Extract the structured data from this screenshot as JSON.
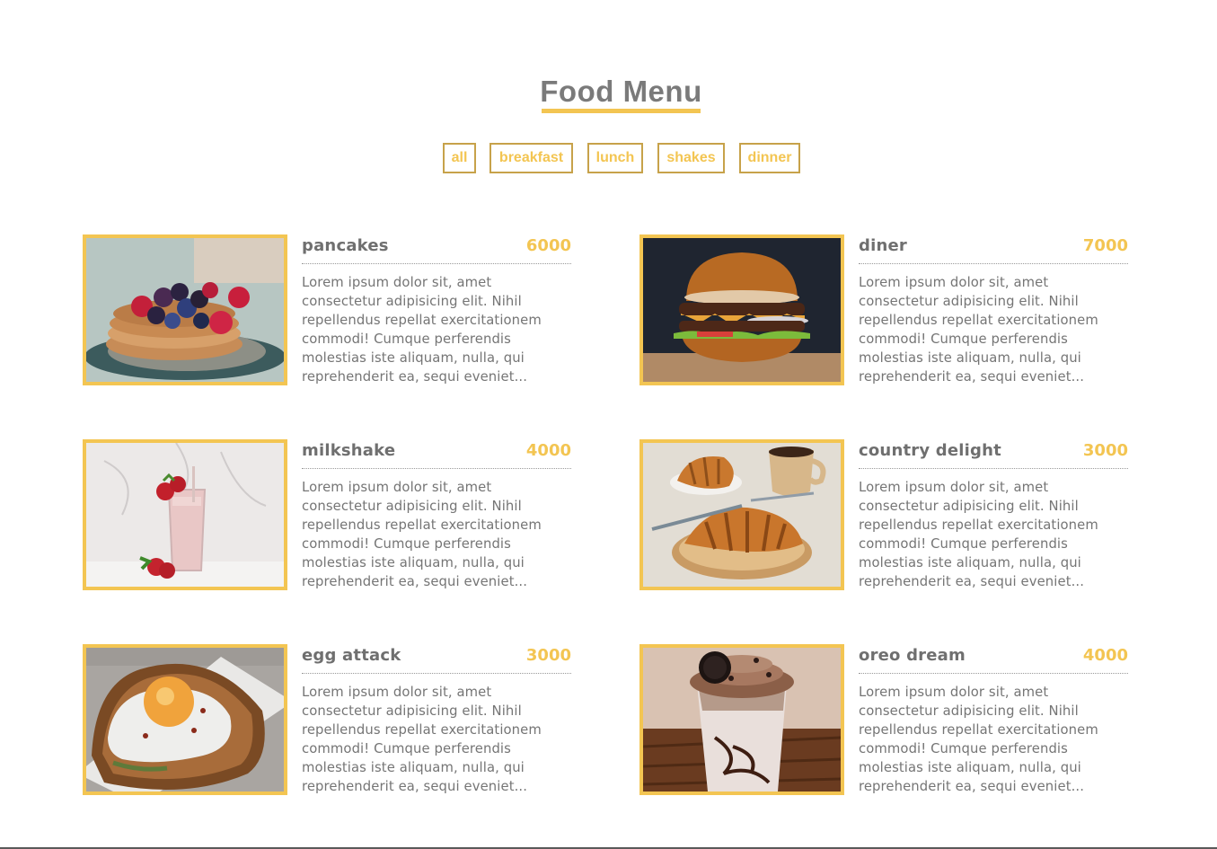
{
  "page": {
    "title": "Food Menu"
  },
  "filters": [
    {
      "label": "all"
    },
    {
      "label": "breakfast"
    },
    {
      "label": "lunch"
    },
    {
      "label": "shakes"
    },
    {
      "label": "dinner"
    }
  ],
  "menu": [
    {
      "name": "pancakes",
      "price": "6000",
      "photo": "pancakes-photo",
      "desc": "Lorem ipsum dolor sit, amet consectetur adipisicing elit. Nihil repellendus repellat exercitationem commodi! Cumque perferendis molestias iste aliquam, nulla, qui reprehenderit ea, sequi eveniet..."
    },
    {
      "name": "diner",
      "price": "7000",
      "photo": "burger-photo",
      "desc": "Lorem ipsum dolor sit, amet consectetur adipisicing elit. Nihil repellendus repellat exercitationem commodi! Cumque perferendis molestias iste aliquam, nulla, qui reprehenderit ea, sequi eveniet..."
    },
    {
      "name": "milkshake",
      "price": "4000",
      "photo": "milkshake-photo",
      "desc": "Lorem ipsum dolor sit, amet consectetur adipisicing elit. Nihil repellendus repellat exercitationem commodi! Cumque perferendis molestias iste aliquam, nulla, qui reprehenderit ea, sequi eveniet..."
    },
    {
      "name": "country delight",
      "price": "3000",
      "photo": "croissant-photo",
      "desc": "Lorem ipsum dolor sit, amet consectetur adipisicing elit. Nihil repellendus repellat exercitationem commodi! Cumque perferendis molestias iste aliquam, nulla, qui reprehenderit ea, sequi eveniet..."
    },
    {
      "name": "egg attack",
      "price": "3000",
      "photo": "egg-toast-photo",
      "desc": "Lorem ipsum dolor sit, amet consectetur adipisicing elit. Nihil repellendus repellat exercitationem commodi! Cumque perferendis molestias iste aliquam, nulla, qui reprehenderit ea, sequi eveniet..."
    },
    {
      "name": "oreo dream",
      "price": "4000",
      "photo": "oreo-shake-photo",
      "desc": "Lorem ipsum dolor sit, amet consectetur adipisicing elit. Nihil repellendus repellat exercitationem commodi! Cumque perferendis molestias iste aliquam, nulla, qui reprehenderit ea, sequi eveniet..."
    }
  ],
  "colors": {
    "accent": "#f3c552",
    "filter_border": "#c7a24a",
    "title": "#7a7a7a",
    "text": "#757575"
  }
}
